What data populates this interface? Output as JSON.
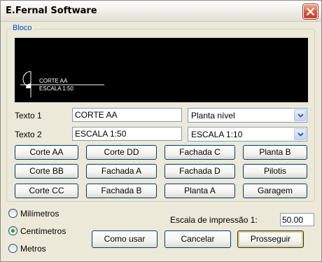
{
  "window": {
    "title": "E.Fernal Software"
  },
  "group": {
    "label": "Bloco"
  },
  "preview": {
    "line1": "CORTE  AA",
    "line2": "ESCALA  1:50"
  },
  "fields": {
    "texto1_label": "Texto 1",
    "texto1_value": "CORTE AA",
    "texto1_combo": "Planta nível",
    "texto2_label": "Texto 2",
    "texto2_value": "ESCALA 1:50",
    "texto2_combo": "ESCALA 1:10"
  },
  "buttons": [
    [
      "Corte AA",
      "Corte DD",
      "Fachada C",
      "Planta B"
    ],
    [
      "Corte BB",
      "Fachada A",
      "Fachada D",
      "Pilotis"
    ],
    [
      "Corte CC",
      "Fachada B",
      "Planta A",
      "Garagem"
    ]
  ],
  "units": {
    "options": [
      "Milímetros",
      "Centímetros",
      "Metros"
    ],
    "selected": "Centímetros"
  },
  "scale": {
    "label": "Escala de impressão 1:",
    "value": "50.00"
  },
  "actions": {
    "como_usar": "Como usar",
    "cancelar": "Cancelar",
    "prosseguir": "Prosseguir"
  },
  "colors": {
    "group_label": "#0046d5",
    "radio_selected": "#21a121",
    "default_button_glow": "#f7c86b"
  }
}
